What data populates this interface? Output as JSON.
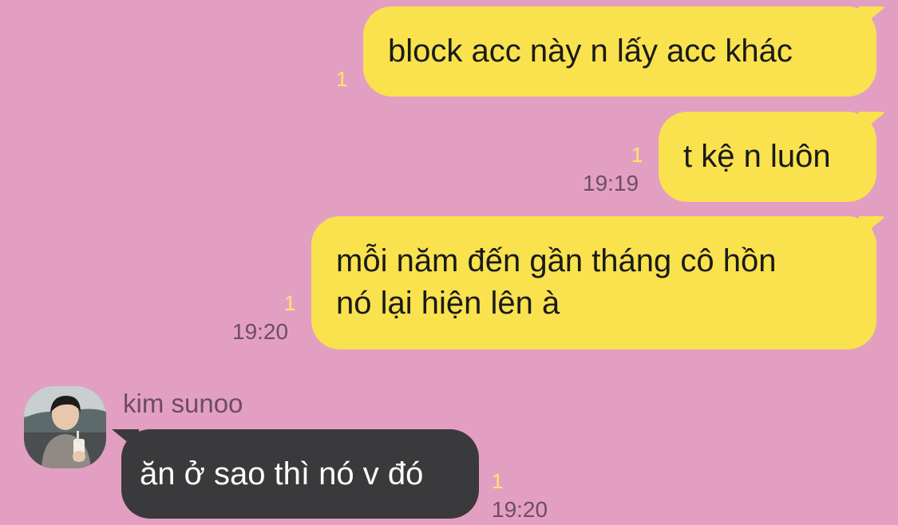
{
  "messages": [
    {
      "direction": "outgoing",
      "text": "block acc này n lấy acc khác",
      "unread": "1",
      "time": ""
    },
    {
      "direction": "outgoing",
      "text": "t kệ n luôn",
      "unread": "1",
      "time": "19:19"
    },
    {
      "direction": "outgoing",
      "lines": [
        "mỗi năm đến gần tháng cô hồn",
        "nó lại hiện lên à"
      ],
      "unread": "1",
      "time": "19:20"
    },
    {
      "direction": "incoming",
      "sender": "kim sunoo",
      "text": "ăn ở sao thì nó v đó",
      "unread": "1",
      "time": "19:20"
    }
  ],
  "colors": {
    "background": "#E39FC2",
    "outgoing_bubble": "#F9E24E",
    "incoming_bubble": "#3A3A3C",
    "unread_count": "#FFE766",
    "timestamp": "#6E4E60"
  },
  "icons": {
    "avatar": "profile-photo"
  }
}
